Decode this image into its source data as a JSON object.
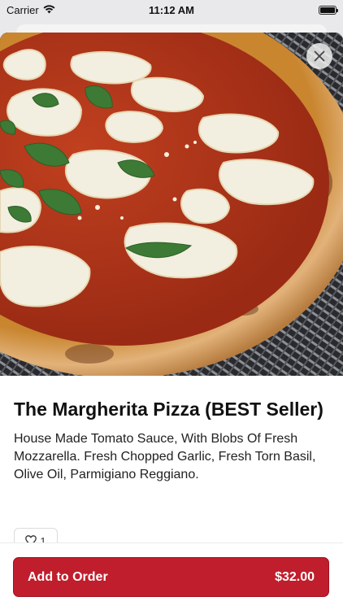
{
  "status_bar": {
    "carrier": "Carrier",
    "time": "11:12 AM",
    "battery_level": 1.0
  },
  "item": {
    "image_alt": "Margherita pizza",
    "title": "The Margherita Pizza (BEST Seller)",
    "description": "House Made Tomato Sauce, With Blobs Of Fresh Mozzarella. Fresh Chopped Garlic, Fresh Torn Basil, Olive Oil, Parmigiano Reggiano.",
    "likes": "1"
  },
  "order": {
    "label": "Add to Order",
    "price": "$32.00"
  },
  "icons": {
    "close": "close-icon",
    "heart": "heart-icon",
    "wifi": "wifi-icon",
    "battery": "battery-icon"
  },
  "colors": {
    "accent": "#c01e2c",
    "sauce": "#b8321c",
    "crust": "#d7a56a",
    "cheese": "#f4f0e2",
    "basil": "#3d7a35"
  }
}
